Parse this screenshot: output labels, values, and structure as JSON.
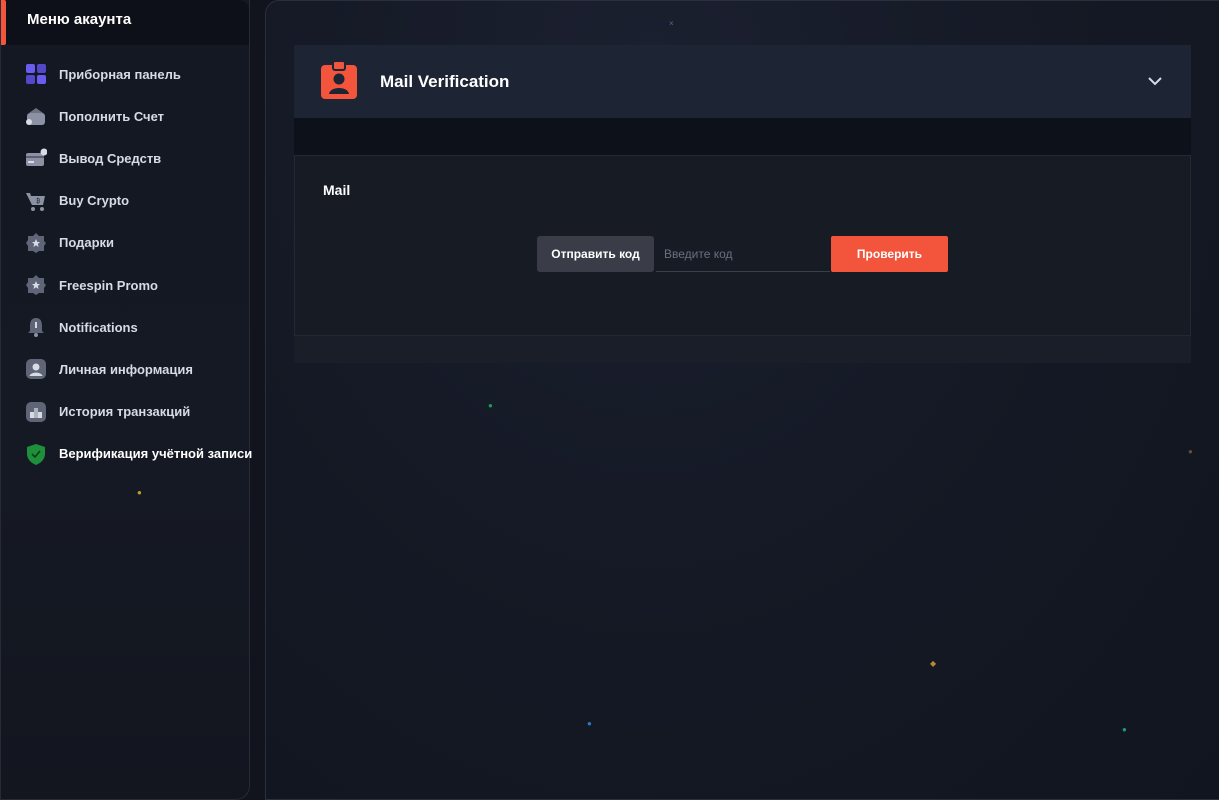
{
  "sidebar": {
    "title": "Меню акаунта",
    "items": [
      {
        "label": "Приборная панель",
        "icon": "dashboard-icon"
      },
      {
        "label": "Пополнить Счет",
        "icon": "wallet-icon"
      },
      {
        "label": "Вывод Средств",
        "icon": "withdraw-card-icon"
      },
      {
        "label": "Buy Crypto",
        "icon": "crypto-cart-icon"
      },
      {
        "label": "Подарки",
        "icon": "gift-badge-icon"
      },
      {
        "label": "Freespin Promo",
        "icon": "promo-badge-icon"
      },
      {
        "label": "Notifications",
        "icon": "bell-icon"
      },
      {
        "label": "Личная информация",
        "icon": "user-icon"
      },
      {
        "label": "История транзакций",
        "icon": "history-icon"
      },
      {
        "label": "Верификация учётной записи",
        "icon": "shield-check-icon",
        "active": true
      }
    ]
  },
  "card": {
    "title": "Mail Verification",
    "icon": "id-badge-icon"
  },
  "mail": {
    "label": "Mail",
    "send_label": "Отправить код",
    "code_placeholder": "Введите код",
    "code_value": "",
    "verify_label": "Проверить"
  },
  "colors": {
    "accent": "#f2543c",
    "active_shield": "#1e8f3a",
    "icon_purple": "#6b5cf0"
  }
}
